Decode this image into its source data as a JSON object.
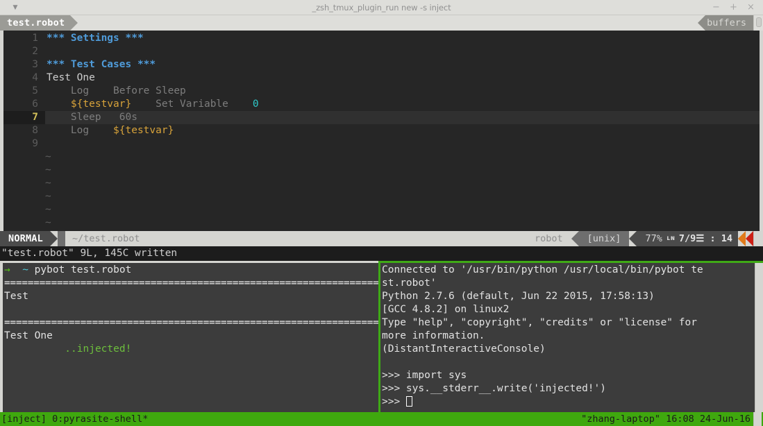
{
  "window": {
    "title": "_zsh_tmux_plugin_run new -s inject",
    "menu_caret": "▼",
    "buttons": {
      "minimize": "−",
      "maximize": "+",
      "close": "×"
    }
  },
  "tabline": {
    "active_tab": "test.robot",
    "buffers_label": "buffers"
  },
  "editor": {
    "lines": [
      {
        "num": "1",
        "current": false,
        "spans": [
          {
            "text": "*** Settings ***",
            "style": "section"
          }
        ]
      },
      {
        "num": "2",
        "current": false,
        "spans": []
      },
      {
        "num": "3",
        "current": false,
        "spans": [
          {
            "text": "*** Test Cases ***",
            "style": "section"
          }
        ]
      },
      {
        "num": "4",
        "current": false,
        "spans": [
          {
            "text": "Test One",
            "style": "plain"
          }
        ]
      },
      {
        "num": "5",
        "current": false,
        "spans": [
          {
            "text": "    Log    Before Sleep",
            "style": "kw"
          }
        ]
      },
      {
        "num": "6",
        "current": false,
        "spans": [
          {
            "text": "    ${testvar}",
            "style": "var"
          },
          {
            "text": "    Set Variable",
            "style": "kw"
          },
          {
            "text": "    0",
            "style": "num"
          }
        ]
      },
      {
        "num": "7",
        "current": true,
        "spans": [
          {
            "text": "    Sleep   60s",
            "style": "kw"
          }
        ]
      },
      {
        "num": "8",
        "current": false,
        "spans": [
          {
            "text": "    Log",
            "style": "kw"
          },
          {
            "text": "    ${testvar}",
            "style": "var"
          }
        ]
      },
      {
        "num": "9",
        "current": false,
        "spans": []
      }
    ],
    "tilde_rows": 6,
    "tilde_char": "~"
  },
  "airline": {
    "mode": "NORMAL",
    "file": "~/test.robot",
    "filetype": "robot",
    "encoding": "[unix]",
    "percent": "77%",
    "nglyph": "ʟɴ",
    "position": "7/9☰ : 14",
    "accent_orange": "#e07a1a",
    "accent_red": "#cc2016"
  },
  "cmdline": {
    "text": "\"test.robot\" 9L, 145C written"
  },
  "left_pane": {
    "lines": [
      {
        "spans": [
          {
            "text": "→",
            "style": "green"
          },
          {
            "text": "  ",
            "style": "plain"
          },
          {
            "text": "~",
            "style": "cyan"
          },
          {
            "text": " pybot test.robot",
            "style": "plain"
          }
        ]
      },
      {
        "spans": [
          {
            "text": "==============================================================================",
            "style": "sep"
          }
        ]
      },
      {
        "spans": [
          {
            "text": "Test",
            "style": "plain"
          }
        ]
      },
      {
        "spans": []
      },
      {
        "spans": [
          {
            "text": "==============================================================================",
            "style": "sep"
          }
        ]
      },
      {
        "spans": [
          {
            "text": "Test One",
            "style": "plain"
          }
        ]
      },
      {
        "spans": [
          {
            "text": "          ..injected!",
            "style": "inj"
          }
        ]
      }
    ]
  },
  "right_pane": {
    "lines": [
      {
        "spans": [
          {
            "text": "Connected to '/usr/bin/python /usr/local/bin/pybot te",
            "style": "plain"
          }
        ]
      },
      {
        "spans": [
          {
            "text": "st.robot'",
            "style": "plain"
          }
        ]
      },
      {
        "spans": [
          {
            "text": "Python 2.7.6 (default, Jun 22 2015, 17:58:13)",
            "style": "plain"
          }
        ]
      },
      {
        "spans": [
          {
            "text": "[GCC 4.8.2] on linux2",
            "style": "plain"
          }
        ]
      },
      {
        "spans": [
          {
            "text": "Type \"help\", \"copyright\", \"credits\" or \"license\" for",
            "style": "plain"
          }
        ]
      },
      {
        "spans": [
          {
            "text": "more information.",
            "style": "plain"
          }
        ]
      },
      {
        "spans": [
          {
            "text": "(DistantInteractiveConsole)",
            "style": "plain"
          }
        ]
      },
      {
        "spans": []
      },
      {
        "spans": [
          {
            "text": ">>> import sys",
            "style": "plain"
          }
        ]
      },
      {
        "spans": [
          {
            "text": ">>> sys.__stderr__.write('injected!')",
            "style": "plain"
          }
        ]
      },
      {
        "spans": [
          {
            "text": ">>> ",
            "style": "plain"
          },
          {
            "text": "",
            "style": "cursor"
          }
        ]
      }
    ]
  },
  "tmux_status": {
    "left": "[inject] 0:pyrasite-shell*",
    "right": "\"zhang-laptop\" 16:08 24-Jun-16",
    "bg": "#3fa80e"
  }
}
